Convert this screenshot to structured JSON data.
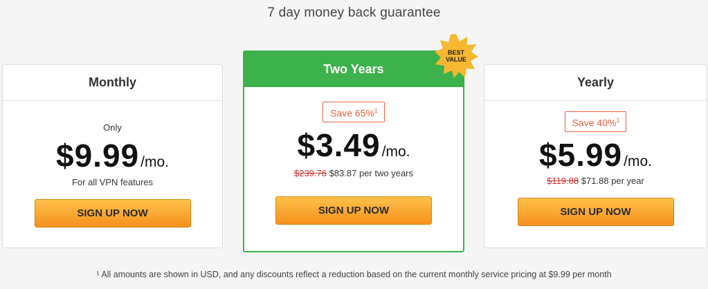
{
  "headline": "7 day money back guarantee",
  "plans": {
    "monthly": {
      "title": "Monthly",
      "only": "Only",
      "price": "$9.99",
      "per": "/mo.",
      "note": "For all VPN features",
      "cta": "SIGN UP NOW"
    },
    "two_years": {
      "title": "Two Years",
      "save": "Save 65%",
      "save_sup": "1",
      "price": "$3.49",
      "per": "/mo.",
      "old_price": "$239.76",
      "new_total": " $83.87 per two years",
      "cta": "SIGN UP NOW",
      "badge_line1": "BEST",
      "badge_line2": "VALUE"
    },
    "yearly": {
      "title": "Yearly",
      "save": "Save 40%",
      "save_sup": "1",
      "price": "$5.99",
      "per": "/mo.",
      "old_price": "$119.88",
      "new_total": " $71.88 per year",
      "cta": "SIGN UP NOW"
    }
  },
  "footnote": "¹ All amounts are shown in USD, and any discounts reflect a reduction based on the current monthly service pricing at $9.99 per month",
  "colors": {
    "accent_green": "#3db14b",
    "save_orange": "#e8603c",
    "strike_red": "#c9302c",
    "cta_top": "#fdc14a",
    "cta_bottom": "#f7901e",
    "badge_gold": "#f7b731"
  }
}
